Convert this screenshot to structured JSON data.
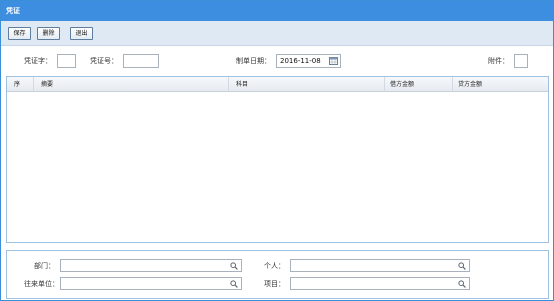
{
  "window": {
    "title": "凭证"
  },
  "toolbar": {
    "save": "保存",
    "delete": "删除",
    "exit": "退出"
  },
  "header": {
    "voucher_word_label": "凭证字：",
    "voucher_no_label": "凭证号：",
    "date_label": "制单日期：",
    "date_value": "2016-11-08",
    "attachments_label": "附件："
  },
  "grid": {
    "columns": [
      "序",
      "摘要",
      "科目",
      "借方金额",
      "贷方金额"
    ],
    "rows": []
  },
  "bottom": {
    "department_label": "部门：",
    "person_label": "个人：",
    "partner_label": "往来单位：",
    "project_label": "项目："
  },
  "colors": {
    "titlebar": "#3d8ee0",
    "toolbar": "#dfe9f4",
    "border": "#9fc1e2"
  }
}
